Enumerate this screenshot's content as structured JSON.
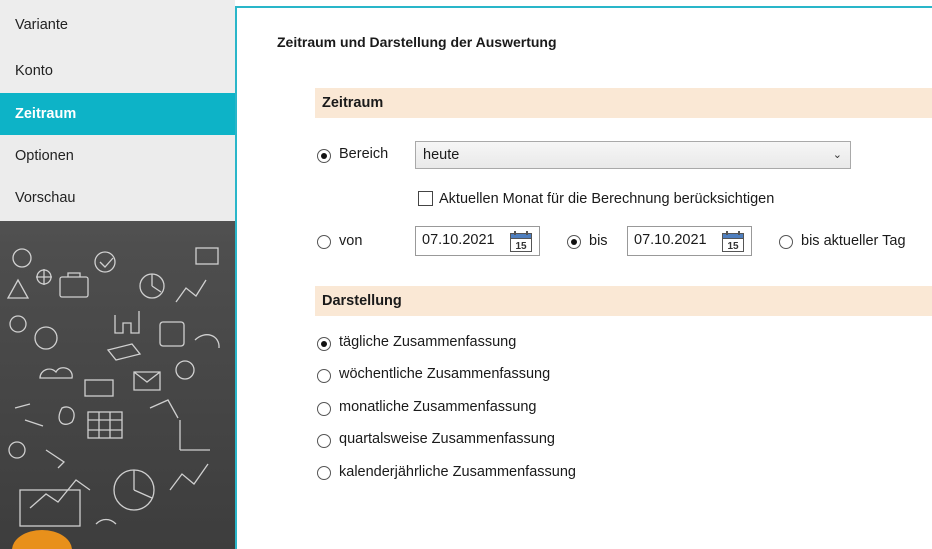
{
  "sidebar": {
    "items": [
      {
        "label": "Variante"
      },
      {
        "label": "Konto"
      },
      {
        "label": "Zeitraum",
        "active": true
      },
      {
        "label": "Optionen"
      },
      {
        "label": "Vorschau"
      }
    ],
    "accent_color": "#0db3c7"
  },
  "main": {
    "title": "Zeitraum und Darstellung der Auswertung",
    "zeitraum": {
      "header": "Zeitraum",
      "bereich_label": "Bereich",
      "bereich_selected": true,
      "bereich_value": "heute",
      "aktueller_monat_label": "Aktuellen Monat für die Berechnung berücksichtigen",
      "aktueller_monat_checked": false,
      "von_label": "von",
      "von_value": "07.10.2021",
      "bis_label": "bis",
      "bis_value": "07.10.2021",
      "bis_aktueller_tag_label": "bis aktueller Tag",
      "calendar_day": "15"
    },
    "darstellung": {
      "header": "Darstellung",
      "options": [
        {
          "label": "tägliche Zusammenfassung",
          "selected": true
        },
        {
          "label": "wöchentliche Zusammenfassung",
          "selected": false
        },
        {
          "label": "monatliche Zusammenfassung",
          "selected": false
        },
        {
          "label": "quartalsweise Zusammenfassung",
          "selected": false
        },
        {
          "label": "kalenderjährliche Zusammenfassung",
          "selected": false
        }
      ]
    },
    "section_header_color": "#fae8d5"
  },
  "icons": [
    "chevron-down-icon",
    "calendar-icon"
  ]
}
